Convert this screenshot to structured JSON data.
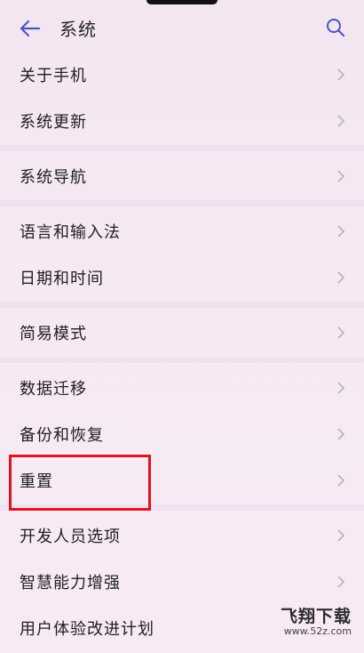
{
  "header": {
    "title": "系统",
    "back_icon": "arrow-left-icon",
    "search_icon": "search-icon"
  },
  "menu": [
    {
      "label": "关于手机"
    },
    {
      "label": "系统更新"
    },
    {
      "label": "系统导航"
    },
    {
      "label": "语言和输入法"
    },
    {
      "label": "日期和时间"
    },
    {
      "label": "简易模式"
    },
    {
      "label": "数据迁移"
    },
    {
      "label": "备份和恢复"
    },
    {
      "label": "重置"
    },
    {
      "label": "开发人员选项"
    },
    {
      "label": "智慧能力增强"
    },
    {
      "label": "用户体验改进计划"
    }
  ],
  "annotation": {
    "highlight_color": "#e0141e"
  },
  "watermark": {
    "brand": "飞翔下载",
    "domain": "www.52z.com"
  },
  "colors": {
    "accent": "#4a55c8",
    "chevron": "#b3b3b8"
  }
}
